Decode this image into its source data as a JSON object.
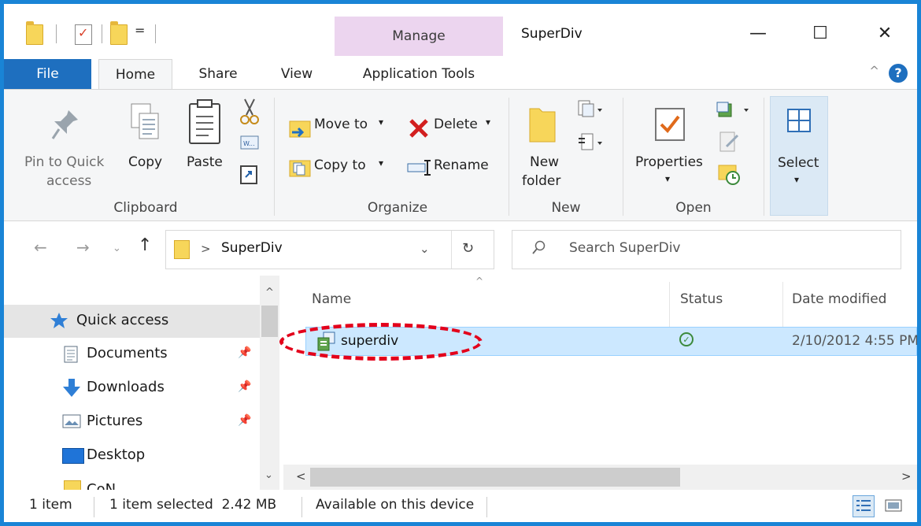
{
  "window": {
    "title": "SuperDiv",
    "context_tab_group": "Manage",
    "controls": {
      "minimize": "—",
      "maximize": "☐",
      "close": "✕"
    },
    "qat_dropdown": "="
  },
  "tabs": {
    "file": "File",
    "home": "Home",
    "share": "Share",
    "view": "View",
    "application_tools": "Application Tools",
    "help": "?",
    "collapse": "^"
  },
  "ribbon": {
    "clipboard": {
      "label": "Clipboard",
      "pin_label_1": "Pin to Quick",
      "pin_label_2": "access",
      "copy": "Copy",
      "paste": "Paste"
    },
    "organize": {
      "label": "Organize",
      "move_to": "Move to",
      "copy_to": "Copy to",
      "delete": "Delete",
      "rename": "Rename"
    },
    "new": {
      "label": "New",
      "new_folder_1": "New",
      "new_folder_2": "folder"
    },
    "open": {
      "label": "Open",
      "properties": "Properties"
    },
    "select": {
      "label": "Select"
    }
  },
  "address": {
    "path": "SuperDiv",
    "separator": ">",
    "search_placeholder": "Search SuperDiv"
  },
  "nav_pane": {
    "items": [
      {
        "label": "Quick access",
        "pinned": false
      },
      {
        "label": "Documents",
        "pinned": true
      },
      {
        "label": "Downloads",
        "pinned": true
      },
      {
        "label": "Pictures",
        "pinned": true
      },
      {
        "label": "Desktop",
        "pinned": false
      },
      {
        "label": "CoN",
        "pinned": false
      }
    ]
  },
  "file_list": {
    "columns": [
      "Name",
      "Status",
      "Date modified"
    ],
    "rows": [
      {
        "name": "superdiv",
        "status": "✓",
        "date_modified": "2/10/2012 4:55 PM"
      }
    ]
  },
  "status_bar": {
    "item_count": "1 item",
    "selection": "1 item selected  2.42 MB",
    "availability": "Available on this device"
  },
  "colors": {
    "window_border": "#1984d6",
    "file_tab": "#1e6fbf",
    "manage_tab": "#ecd5ef",
    "selection": "#cce8ff",
    "annotation": "#e3001b"
  }
}
